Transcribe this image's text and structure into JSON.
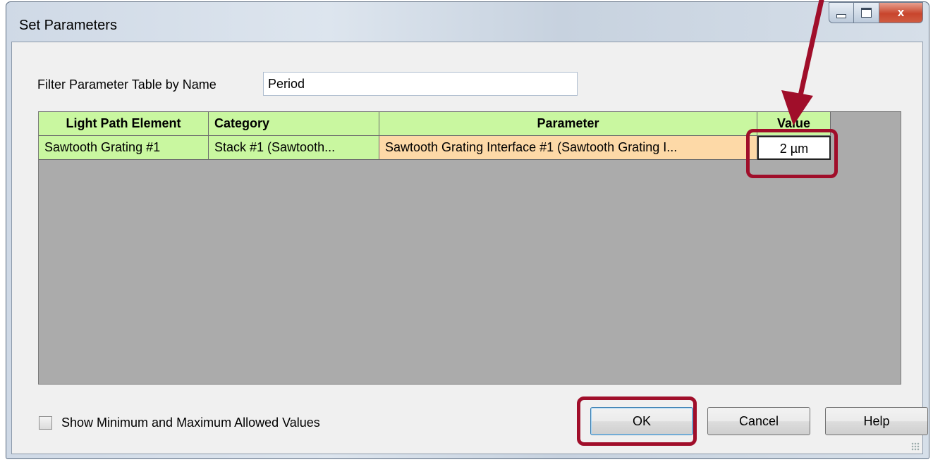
{
  "window": {
    "title": "Set Parameters",
    "close_glyph": "x"
  },
  "filter": {
    "label": "Filter Parameter Table by Name",
    "value": "Period"
  },
  "table": {
    "columns": [
      "Light Path Element",
      "Category",
      "Parameter",
      "Value"
    ],
    "rows": [
      [
        "Sawtooth Grating #1",
        "Stack #1 (Sawtooth...",
        "Sawtooth Grating Interface #1 (Sawtooth Grating I...",
        "2 µm"
      ]
    ]
  },
  "checkbox": {
    "label": "Show Minimum and Maximum Allowed Values",
    "checked": false
  },
  "buttons": {
    "ok": "OK",
    "cancel": "Cancel",
    "help": "Help"
  },
  "icons": [
    "minimize-icon",
    "maximize-icon",
    "close-icon",
    "resize-grip-icon",
    "annotation-arrow-icon"
  ],
  "colors": {
    "header_bg": "#c9f7a0",
    "parameter_bg": "#fdd9a7",
    "annotation": "#a00e2a"
  }
}
